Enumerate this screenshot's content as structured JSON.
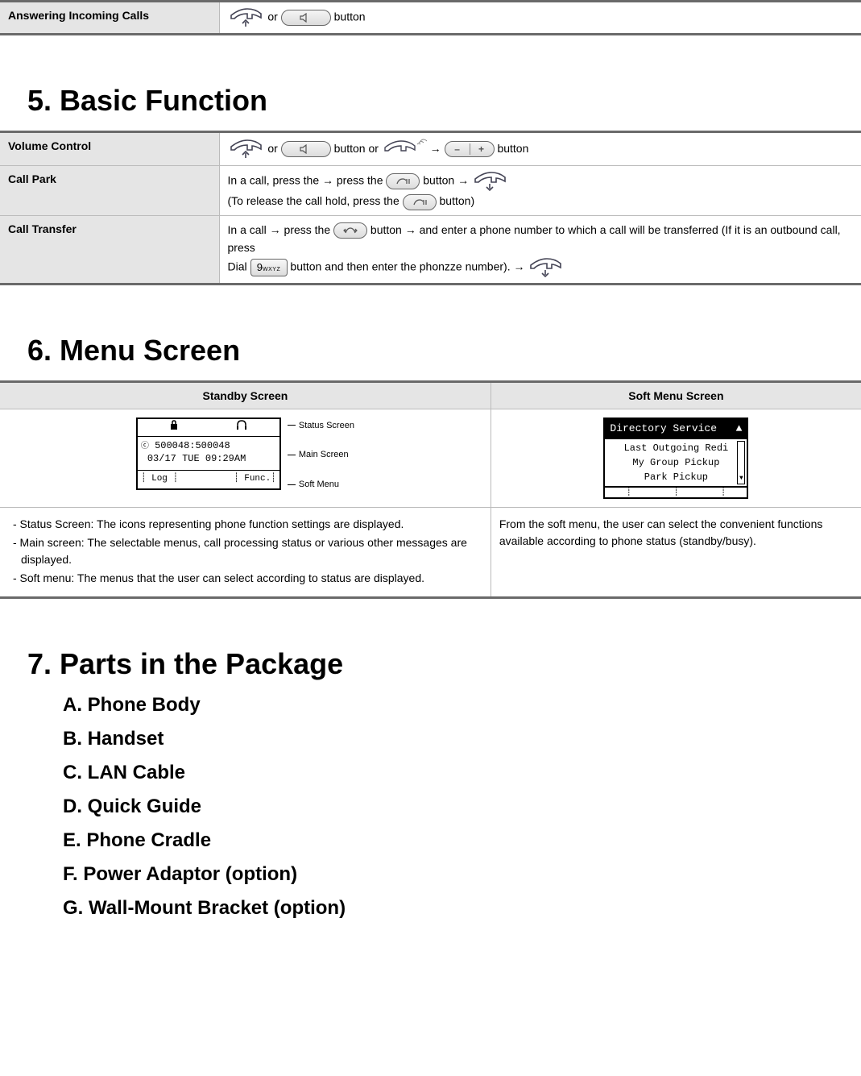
{
  "top_row": {
    "label": "Answering Incoming Calls",
    "or": " or ",
    "button_word": " button"
  },
  "section5": {
    "title_num": "5.",
    "title": "Basic Function",
    "rows": {
      "volume": {
        "label": "Volume Control",
        "or": " or ",
        "button_or": " button or ",
        "arrow": " → ",
        "button_word": " button"
      },
      "park": {
        "label": "Call Park",
        "l1a": "In a call, press the → press the ",
        "l1b": " button → ",
        "l2a": "(To release the call hold, press the ",
        "l2b": " button)"
      },
      "transfer": {
        "label": "Call Transfer",
        "l1a": "In a call → press the ",
        "l1b": " button → and enter a phone number to which a call will be transferred (If it is an outbound call, press",
        "l2a": "Dial ",
        "l2b": " button and then enter the phonzze number). → ",
        "key9": "9",
        "key9sub": "WXYZ"
      }
    }
  },
  "section6": {
    "title_num": "6.",
    "title": "Menu Screen",
    "headers": {
      "standby": "Standby Screen",
      "soft": "Soft Menu Screen"
    },
    "standby_lcd": {
      "main_line1": "500048:500048",
      "main_line2": "03/17 TUE 09:29AM",
      "soft_left": "Log",
      "soft_right": "Func.",
      "label_status": "Status Screen",
      "label_main": "Main Screen",
      "label_soft": "Soft Menu"
    },
    "soft_lcd": {
      "header": "Directory Service",
      "l1": "Last Outgoing Redi",
      "l2": "My Group Pickup",
      "l3": "Park Pickup"
    },
    "standby_desc": {
      "d1": "- Status Screen: The icons representing phone function settings are displayed.",
      "d2": "- Main screen: The selectable menus, call processing status or various other messages are displayed.",
      "d3": "- Soft menu: The menus that the user can select according to status are displayed."
    },
    "soft_desc": "From the soft menu, the user can select the convenient functions available according to phone status (standby/busy)."
  },
  "section7": {
    "title_num": "7.",
    "title": "Parts in the Package",
    "items": {
      "a": "A. Phone Body",
      "b": "B. Handset",
      "c": "C. LAN Cable",
      "d": "D. Quick Guide",
      "e": "E. Phone Cradle",
      "f": "F.  Power Adaptor (option)",
      "g": "G. Wall-Mount Bracket (option)"
    }
  }
}
